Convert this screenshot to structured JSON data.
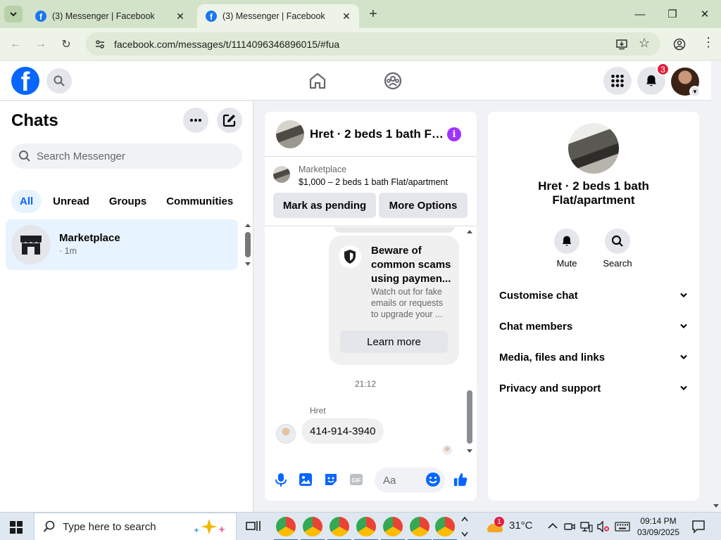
{
  "browser": {
    "tabs": [
      {
        "title": "(3) Messenger | Facebook",
        "active": false
      },
      {
        "title": "(3) Messenger | Facebook",
        "active": true
      }
    ],
    "url": "facebook.com/messages/t/1114096346896015/#fua"
  },
  "header": {
    "notification_count": "3"
  },
  "chats": {
    "title": "Chats",
    "search_placeholder": "Search Messenger",
    "filters": [
      "All",
      "Unread",
      "Groups",
      "Communities"
    ],
    "items": [
      {
        "name": "Marketplace",
        "time": "· 1m"
      }
    ]
  },
  "conversation": {
    "title": "Hret · 2 beds 1 bath Flat/apartment",
    "marketplace_label": "Marketplace",
    "listing": "$1,000 – 2 beds 1 bath Flat/apartment",
    "mark_pending_label": "Mark as pending",
    "more_options_label": "More Options",
    "scam_card": {
      "title": "Beware of common scams using paymen...",
      "body": "Watch out for fake emails or requests to upgrade your ...",
      "button": "Learn more"
    },
    "timestamp": "21:12",
    "sender": "Hret",
    "message": "414-914-3940",
    "input_placeholder": "Aa"
  },
  "info": {
    "title_line1": "Hret · 2 beds 1 bath",
    "title_line2": "Flat/apartment",
    "mute_label": "Mute",
    "search_label": "Search",
    "sections": [
      "Customise chat",
      "Chat members",
      "Media, files and links",
      "Privacy and support"
    ]
  },
  "taskbar": {
    "search_placeholder": "Type here to search",
    "weather": "31°C",
    "weather_badge": "1",
    "time": "09:14 PM",
    "date": "03/09/2025"
  },
  "colors": {
    "facebook_blue": "#0866ff",
    "active_chat_bg": "#e7f3ff",
    "badge_red": "#e41e3f",
    "info_purple": "#a033ff"
  }
}
